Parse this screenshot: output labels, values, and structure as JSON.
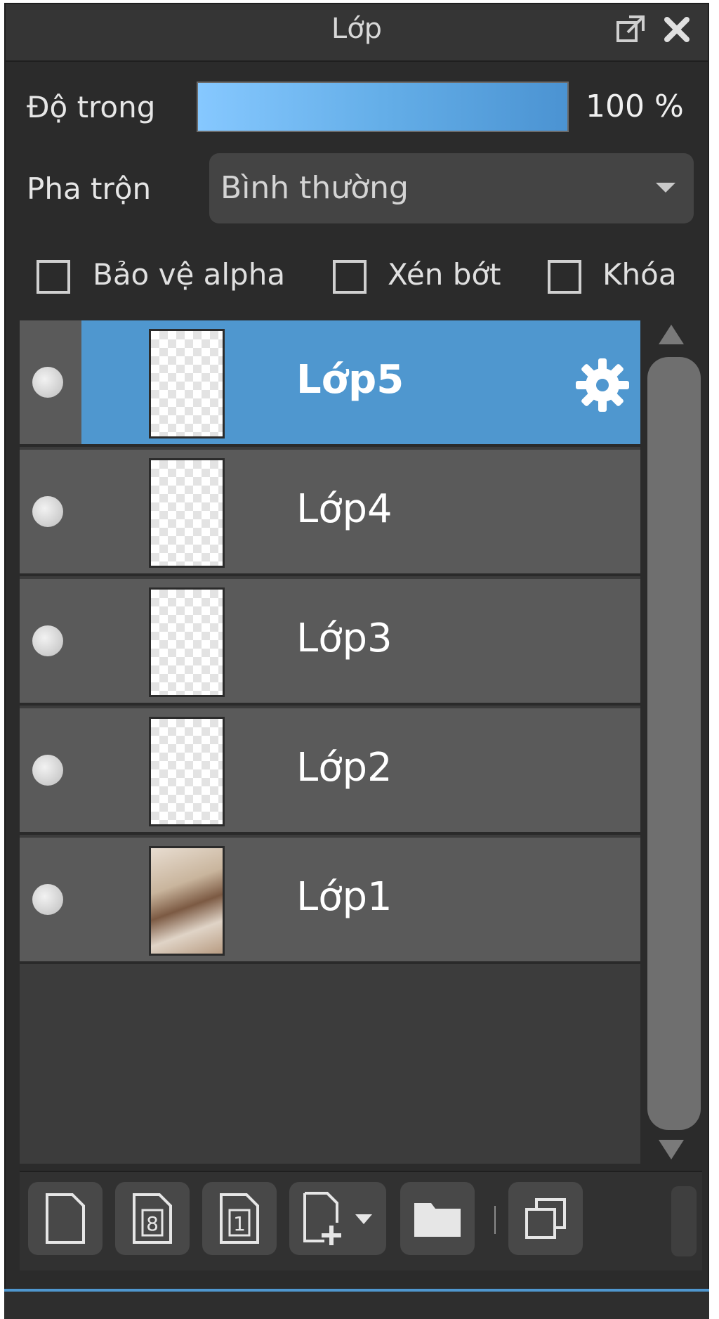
{
  "panel": {
    "title": "Lớp",
    "opacity_label": "Độ trong",
    "opacity_value_text": "100 %",
    "opacity_fraction": 1.0,
    "blend_label": "Pha trộn",
    "blend_value": "Bình thường",
    "checkboxes": [
      {
        "label": "Bảo vệ alpha",
        "checked": false
      },
      {
        "label": "Xén bớt",
        "checked": false
      },
      {
        "label": "Khóa",
        "checked": false
      }
    ]
  },
  "layers": [
    {
      "name": "Lớp5",
      "selected": true
    },
    {
      "name": "Lớp4",
      "selected": false
    },
    {
      "name": "Lớp3",
      "selected": false
    },
    {
      "name": "Lớp2",
      "selected": false
    },
    {
      "name": "Lớp1",
      "selected": false
    }
  ],
  "toolbar": {
    "buttons": [
      {
        "icon": "new-layer-icon",
        "label": ""
      },
      {
        "icon": "new-layer-8bit-icon",
        "label": "8"
      },
      {
        "icon": "new-layer-1bit-icon",
        "label": "1"
      },
      {
        "icon": "add-layer-dropdown-icon",
        "label": ""
      },
      {
        "icon": "folder-icon",
        "label": ""
      },
      {
        "icon": "duplicate-layer-icon",
        "label": ""
      }
    ]
  },
  "colors": {
    "accent": "#4f97cf",
    "panel_bg": "#2b2b2b",
    "layer_bg": "#5a5a5a"
  }
}
